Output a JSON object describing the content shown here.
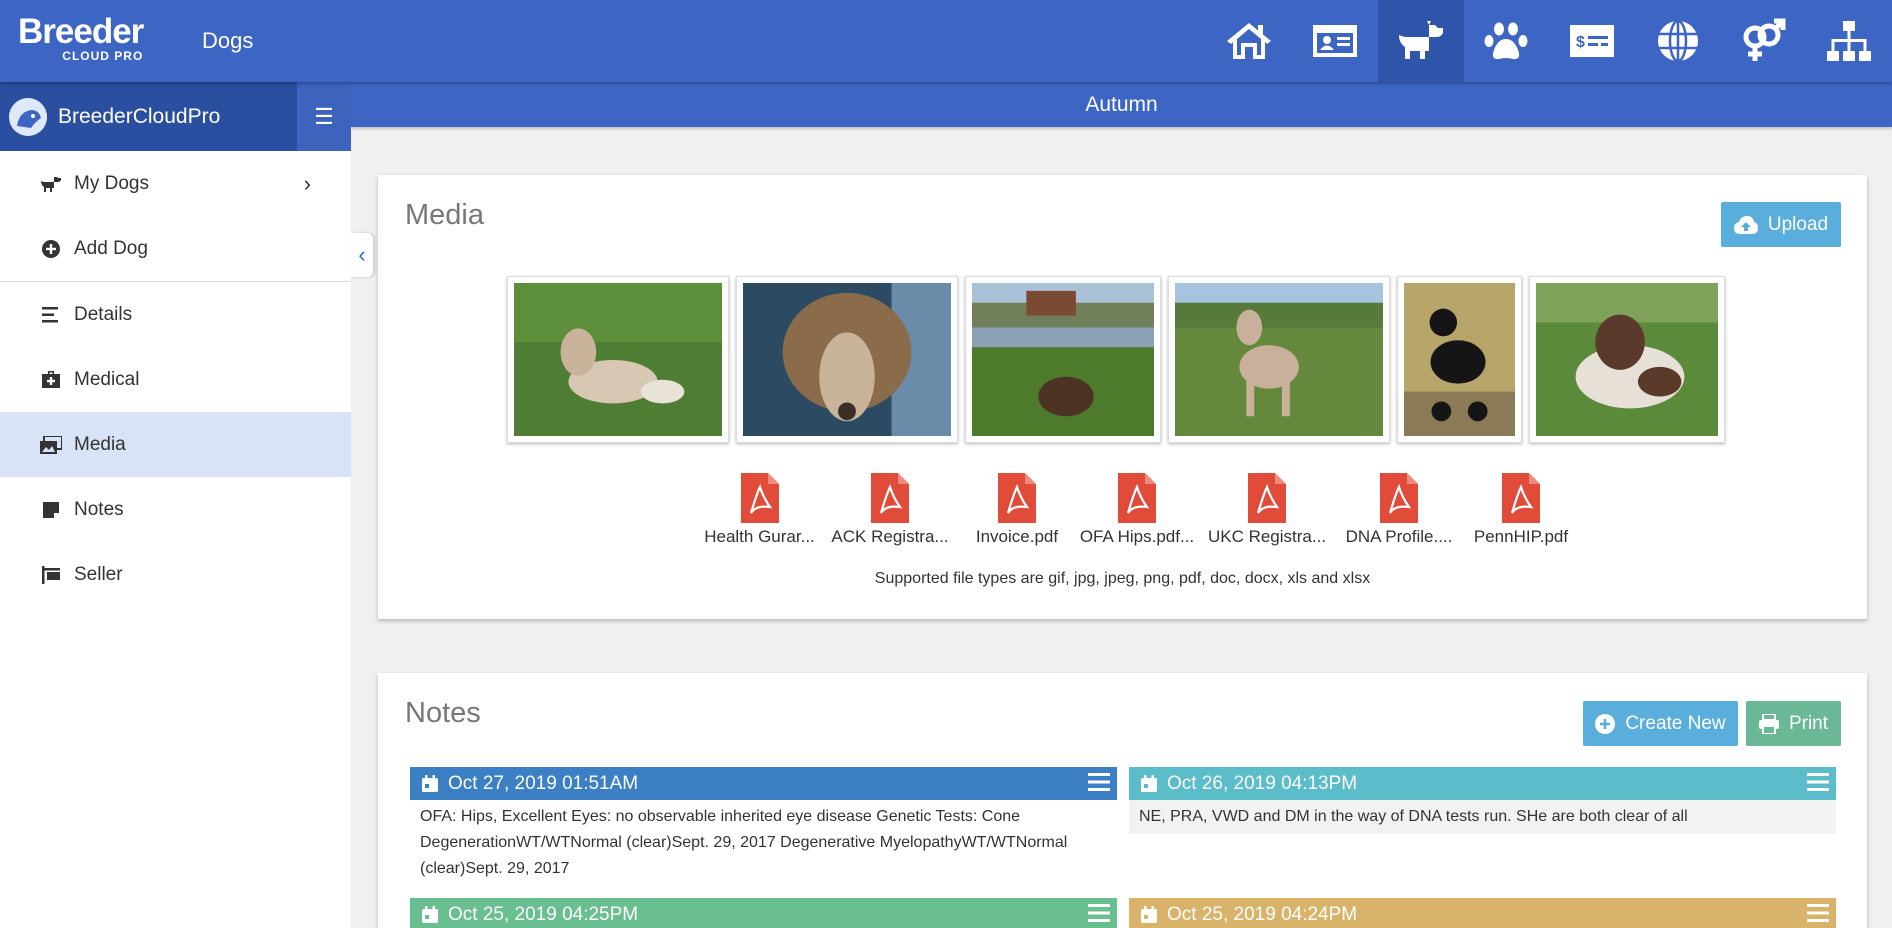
{
  "app": {
    "logo_main": "Breeder",
    "logo_sub": "CLOUD PRO",
    "section_title": "Dogs"
  },
  "topnav": [
    {
      "icon": "home-icon",
      "label": "Home"
    },
    {
      "icon": "id-card-icon",
      "label": "Contacts"
    },
    {
      "icon": "dog-icon",
      "label": "Dogs",
      "active": true
    },
    {
      "icon": "paw-icon",
      "label": "Litters"
    },
    {
      "icon": "money-check-icon",
      "label": "Finance"
    },
    {
      "icon": "globe-icon",
      "label": "Website"
    },
    {
      "icon": "gender-icon",
      "label": "Breeding"
    },
    {
      "icon": "sitemap-icon",
      "label": "Pedigree"
    }
  ],
  "sidebar": {
    "brand": "BreederCloudPro",
    "items": [
      {
        "label": "My Dogs",
        "icon": "dog-small-icon"
      },
      {
        "label": "Add Dog",
        "icon": "plus-circle-icon"
      },
      {
        "label": "Details",
        "icon": "align-left-icon"
      },
      {
        "label": "Medical",
        "icon": "medkit-icon"
      },
      {
        "label": "Media",
        "icon": "images-icon",
        "active": true
      },
      {
        "label": "Notes",
        "icon": "sticky-note-icon"
      },
      {
        "label": "Seller",
        "icon": "sign-icon"
      }
    ]
  },
  "dog_name": "Autumn",
  "media": {
    "title": "Media",
    "upload_label": "Upload",
    "photos": [
      "Poodle lying on grass",
      "Poodle close-up face",
      "Brown poodle lying in grass by pond",
      "Standing clipped poodle",
      "Black poodle at show",
      "Brown and white poodle lying in grass"
    ],
    "files": [
      {
        "name": "Health Gurar..."
      },
      {
        "name": "ACK Registra..."
      },
      {
        "name": "Invoice.pdf"
      },
      {
        "name": "OFA Hips.pdf..."
      },
      {
        "name": "UKC Registra..."
      },
      {
        "name": "DNA Profile...."
      },
      {
        "name": "PennHIP.pdf"
      }
    ],
    "supported_text": "Supported file types are gif, jpg, jpeg, png, pdf, doc, docx, xls and xlsx"
  },
  "notes": {
    "title": "Notes",
    "create_label": "Create New",
    "print_label": "Print",
    "entries": [
      {
        "date": "Oct 27, 2019 01:51AM",
        "color": "#3b7fc4",
        "text": "OFA: Hips, Excellent Eyes: no observable inherited eye disease Genetic Tests: Cone DegenerationWT/WTNormal (clear)Sept. 29, 2017 Degenerative MyelopathyWT/WTNormal (clear)Sept. 29, 2017"
      },
      {
        "date": "Oct 26, 2019 04:13PM",
        "color": "#5bbdc9",
        "text": "NE, PRA, VWD and DM in the way of DNA tests run. SHe are both clear of all"
      },
      {
        "date": "Oct 25, 2019 04:25PM",
        "color": "#69bf8f",
        "text": ""
      },
      {
        "date": "Oct 25, 2019 04:24PM",
        "color": "#d9b36a",
        "text": ""
      }
    ]
  },
  "colors": {
    "primary": "#3d66c4",
    "sidebar_head": "#2b4fa0",
    "upload": "#5aaedb",
    "print": "#6bb896",
    "pdf_red": "#e04b3a"
  }
}
